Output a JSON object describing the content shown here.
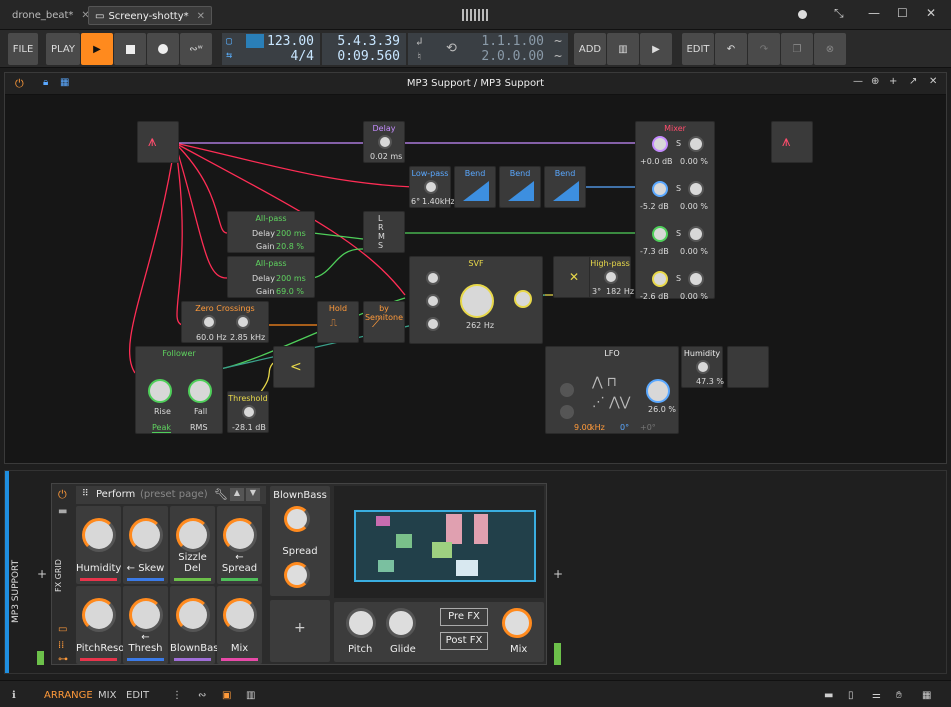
{
  "tabs": [
    {
      "label": "drone_beat*"
    },
    {
      "label": "Screeny-shotty*"
    }
  ],
  "transport": {
    "file": "FILE",
    "play": "PLAY",
    "tempo": "123.00",
    "signature": "4/4",
    "position": "5.4.3.39",
    "time": "0:09.560",
    "loop_start": "1.1.1.00",
    "loop_len": "2.0.0.00",
    "add": "ADD",
    "edit": "EDIT"
  },
  "device": {
    "title": "MP3 Support / MP3 Support",
    "modules": {
      "delay": {
        "title": "Delay",
        "value": "0.02 ms"
      },
      "lowpass": {
        "title": "Low-pass",
        "value": "1.40kHz",
        "slope": "6°"
      },
      "bend": [
        "Bend",
        "Bend",
        "Bend"
      ],
      "allpass1": {
        "title": "All-pass",
        "delay_label": "Delay",
        "delay": "200 ms",
        "gain_label": "Gain",
        "gain": "20.8 %"
      },
      "allpass2": {
        "title": "All-pass",
        "delay_label": "Delay",
        "delay": "200 ms",
        "gain_label": "Gain",
        "gain": "69.0 %"
      },
      "lrms": [
        "L",
        "R",
        "M",
        "S"
      ],
      "svf": {
        "title": "SVF",
        "value": "262 Hz"
      },
      "highpass": {
        "title": "High-pass",
        "value": "182 Hz",
        "slope": "3°"
      },
      "zero": {
        "title": "Zero Crossings",
        "v1": "60.0 Hz",
        "v2": "2.85 kHz"
      },
      "hold": {
        "title": "Hold"
      },
      "semitone": {
        "title": "by Semitone"
      },
      "follower": {
        "title": "Follower",
        "rise": "Rise",
        "fall": "Fall",
        "peak": "Peak",
        "rms": "RMS"
      },
      "threshold": {
        "title": "Threshold",
        "value": "-28.1 dB"
      },
      "lfo": {
        "title": "LFO",
        "rate": "9.00",
        "unit": "kHz",
        "phase": "0°",
        "offset": "+0°",
        "amount": "26.0 %"
      },
      "humidity": {
        "title": "Humidity",
        "value": "47.3 %"
      },
      "mixer": {
        "title": "Mixer",
        "rows": [
          {
            "db": "+0.0 dB",
            "pct": "0.00 %"
          },
          {
            "db": "-5.2 dB",
            "pct": "0.00 %"
          },
          {
            "db": "-7.3 dB",
            "pct": "0.00 %"
          },
          {
            "db": "-2.6 dB",
            "pct": "0.00 %"
          }
        ],
        "s": "S"
      }
    }
  },
  "bottom": {
    "side_label": "MP3 SUPPORT",
    "fx_grid": "FX GRID",
    "preset": "Perform",
    "preset_sub": "(preset page)",
    "cells": [
      {
        "label": "Humidity",
        "color": "#e8344b"
      },
      {
        "label": "← Skew",
        "color": "#3b7be8"
      },
      {
        "label": "Sizzle Del",
        "color": "#6cc04a"
      },
      {
        "label": "← Spread",
        "color": "#4fbf5a"
      },
      {
        "label": "PitchReso",
        "color": "#e8344b"
      },
      {
        "label": "← Thresh",
        "color": "#3b7be8"
      },
      {
        "label": "BlownBass",
        "color": "#a06ed8"
      },
      {
        "label": "Mix",
        "color": "#e84aa8"
      }
    ],
    "macro1": "BlownBass",
    "macro2": "Spread",
    "pitch": "Pitch",
    "glide": "Glide",
    "prefx": "Pre FX",
    "postfx": "Post FX",
    "mix": "Mix"
  },
  "status": {
    "arrange": "ARRANGE",
    "mix": "MIX",
    "edit": "EDIT"
  }
}
